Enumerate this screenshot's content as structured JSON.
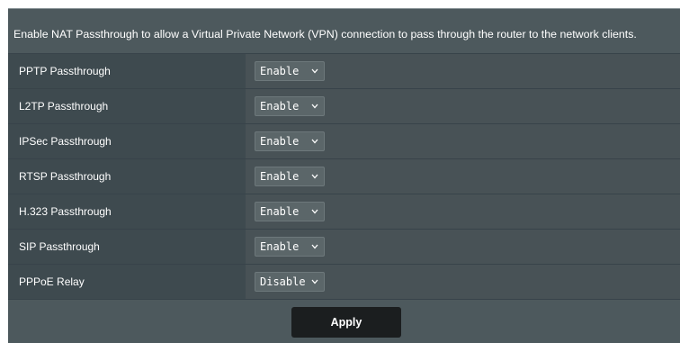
{
  "description": "Enable NAT Passthrough to allow a Virtual Private Network (VPN) connection to pass through the router to the network clients.",
  "rows": [
    {
      "label": "PPTP Passthrough",
      "value": "Enable"
    },
    {
      "label": "L2TP Passthrough",
      "value": "Enable"
    },
    {
      "label": "IPSec Passthrough",
      "value": "Enable"
    },
    {
      "label": "RTSP Passthrough",
      "value": "Enable"
    },
    {
      "label": "H.323 Passthrough",
      "value": "Enable"
    },
    {
      "label": "SIP Passthrough",
      "value": "Enable"
    },
    {
      "label": "PPPoE Relay",
      "value": "Disable"
    }
  ],
  "apply_label": "Apply",
  "icons": {
    "dropdown": "chevron-down-icon"
  },
  "colors": {
    "panel_bg": "#4d595d",
    "label_bg": "#3e4a4f",
    "value_bg": "#485256",
    "select_bg": "#5b6669",
    "button_bg": "#1b1e1f",
    "text": "#ffffff"
  }
}
